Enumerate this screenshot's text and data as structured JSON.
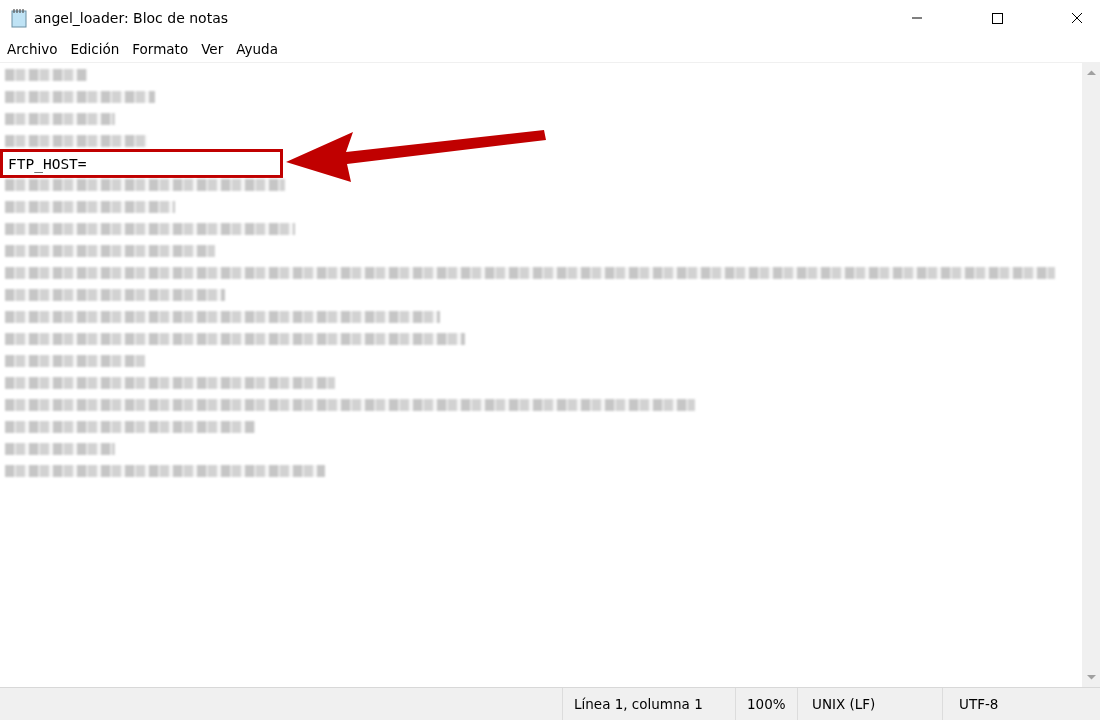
{
  "window": {
    "title": "angel_loader: Bloc de notas"
  },
  "menu": [
    "Archivo",
    "Edición",
    "Formato",
    "Ver",
    "Ayuda"
  ],
  "editor": {
    "lines": [
      {
        "kind": "blurred"
      },
      {
        "kind": "blurred"
      },
      {
        "kind": "blurred"
      },
      {
        "kind": "blurred"
      },
      {
        "kind": "text",
        "text": "FTP_HOST=",
        "highlighted": true
      },
      {
        "kind": "blurred"
      },
      {
        "kind": "blurred"
      },
      {
        "kind": "blurred"
      },
      {
        "kind": "blurred"
      },
      {
        "kind": "blurred"
      },
      {
        "kind": "blurred"
      },
      {
        "kind": "blurred"
      },
      {
        "kind": "blurred"
      },
      {
        "kind": "blurred"
      },
      {
        "kind": "blurred"
      },
      {
        "kind": "blurred"
      },
      {
        "kind": "blurred"
      },
      {
        "kind": "blurred"
      },
      {
        "kind": "blurred"
      }
    ]
  },
  "status_bar": [
    "Línea 1, columna 1",
    "100%",
    "UNIX (LF)",
    "UTF-8"
  ]
}
